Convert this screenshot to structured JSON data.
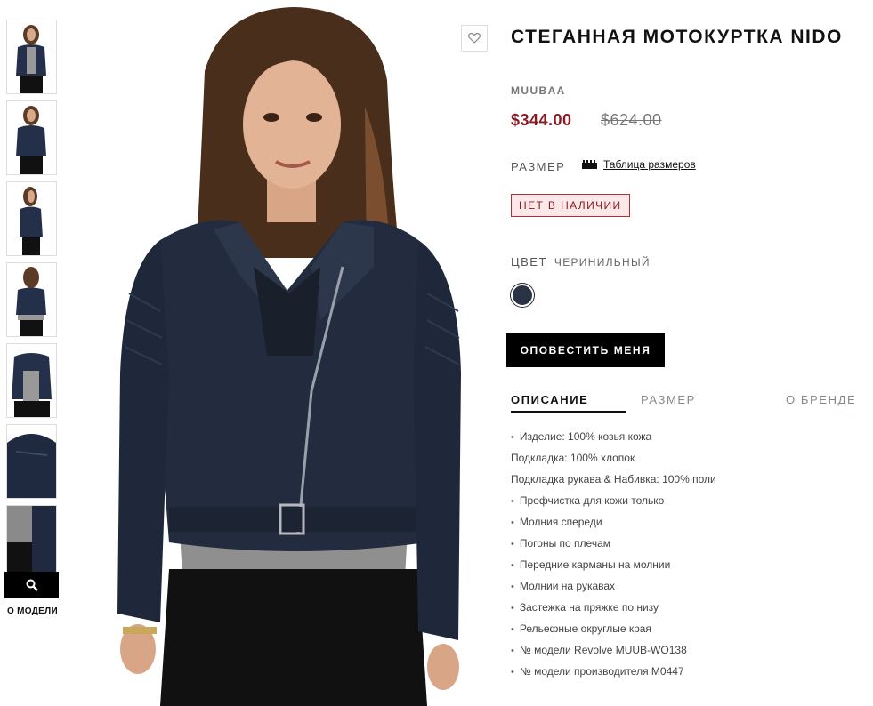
{
  "product": {
    "title": "СТЕГАННАЯ МОТОКУРТКА NIDO",
    "brand": "MUUBAA",
    "price_sale": "$344.00",
    "price_original": "$624.00",
    "size_label": "РАЗМЕР",
    "size_chart_link": "Таблица размеров",
    "stock_status": "НЕТ В НАЛИЧИИ",
    "color_label": "ЦВЕТ",
    "color_value": "ЧЕРИНИЛЬНЫЙ",
    "notify_button": "ОПОВЕСТИТЬ МЕНЯ"
  },
  "colors": {
    "sale_price": "#8a1b22",
    "swatch": "#2a3345",
    "badge_bg": "#fbe9ea"
  },
  "gallery": {
    "thumbnail_count": 7,
    "about_model_label": "О МОДЕЛИ"
  },
  "tabs": [
    {
      "label": "ОПИСАНИЕ",
      "active": true
    },
    {
      "label": "РАЗМЕР",
      "active": false
    },
    {
      "label": "О БРЕНДЕ",
      "active": false
    }
  ],
  "description": [
    {
      "text": "Изделие: 100% козья кожа",
      "bullet": true
    },
    {
      "text": "Подкладка: 100% хлопок",
      "bullet": false
    },
    {
      "text": "Подкладка рукава & Набивка: 100% поли",
      "bullet": false
    },
    {
      "text": "Профчистка для кожи только",
      "bullet": true
    },
    {
      "text": "Молния спереди",
      "bullet": true
    },
    {
      "text": "Погоны по плечам",
      "bullet": true
    },
    {
      "text": "Передние карманы на молнии",
      "bullet": true
    },
    {
      "text": "Молнии на рукавах",
      "bullet": true
    },
    {
      "text": "Застежка на пряжке по низу",
      "bullet": true
    },
    {
      "text": "Рельефные округлые края",
      "bullet": true
    },
    {
      "text": "№ модели Revolve MUUB-WO138",
      "bullet": true
    },
    {
      "text": "№ модели производителя M0447",
      "bullet": true
    }
  ]
}
